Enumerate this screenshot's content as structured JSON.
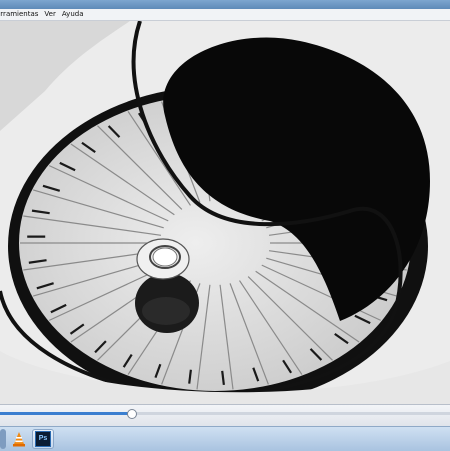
{
  "window": {
    "menu": [
      "erramientas",
      "Ver",
      "Ayuda"
    ]
  },
  "player": {
    "progress": 0.29
  },
  "taskbar": {
    "apps": [
      {
        "name": "vlc-icon",
        "label": ""
      },
      {
        "name": "photoshop-icon",
        "label": "Ps"
      }
    ]
  },
  "colors": {
    "seek_fill": "#3b7fd0",
    "taskbar": "#bcd2ea"
  }
}
